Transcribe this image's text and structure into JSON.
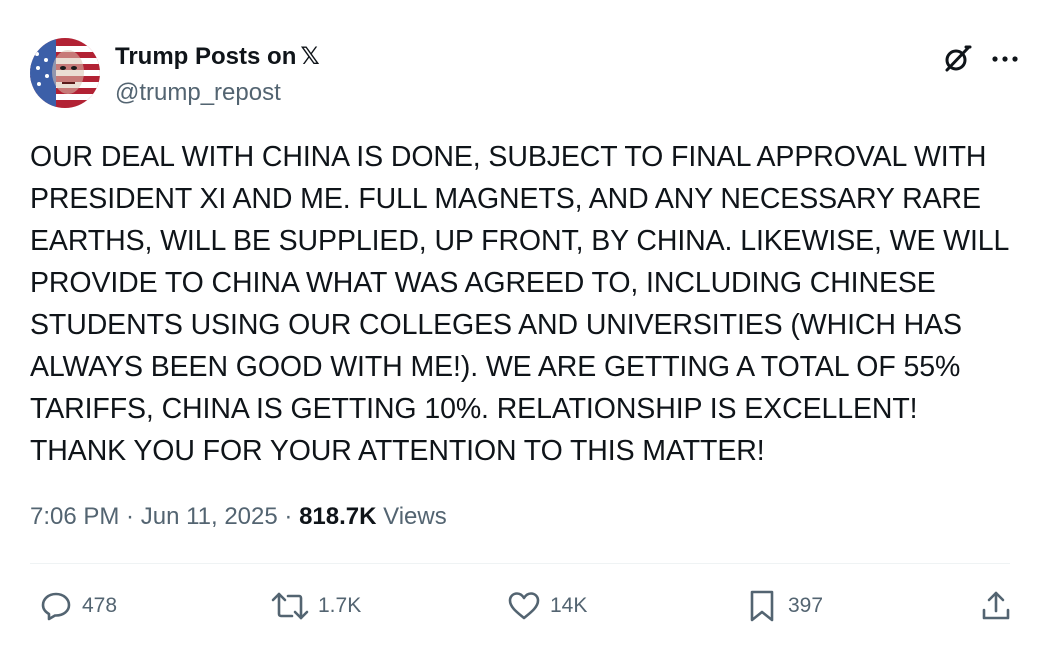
{
  "author": {
    "name": "Trump Posts on",
    "name_badge": "𝕏",
    "handle": "@trump_repost"
  },
  "post": {
    "text": "OUR DEAL WITH CHINA IS DONE, SUBJECT TO FINAL APPROVAL WITH PRESIDENT XI AND ME. FULL MAGNETS, AND ANY NECESSARY RARE EARTHS, WILL BE SUPPLIED, UP FRONT, BY CHINA. LIKEWISE, WE WILL PROVIDE TO CHINA WHAT WAS AGREED TO, INCLUDING CHINESE STUDENTS USING OUR COLLEGES AND UNIVERSITIES (WHICH HAS ALWAYS BEEN GOOD WITH ME!). WE ARE GETTING A TOTAL OF 55% TARIFFS, CHINA IS GETTING 10%. RELATIONSHIP IS EXCELLENT! THANK YOU FOR YOUR ATTENTION TO THIS MATTER!"
  },
  "meta": {
    "time": "7:06 PM",
    "separator": " · ",
    "date": "Jun 11, 2025",
    "views_count": "818.7K",
    "views_label": " Views"
  },
  "actions": {
    "replies": "478",
    "reposts": "1.7K",
    "likes": "14K",
    "bookmarks": "397"
  },
  "icons": {
    "header": [
      "grok-icon",
      "more-icon"
    ],
    "actions": [
      "reply-icon",
      "repost-icon",
      "like-icon",
      "bookmark-icon",
      "share-icon"
    ]
  },
  "colors": {
    "text_primary": "#0f1419",
    "text_secondary": "#536471",
    "divider": "#eff3f4"
  }
}
